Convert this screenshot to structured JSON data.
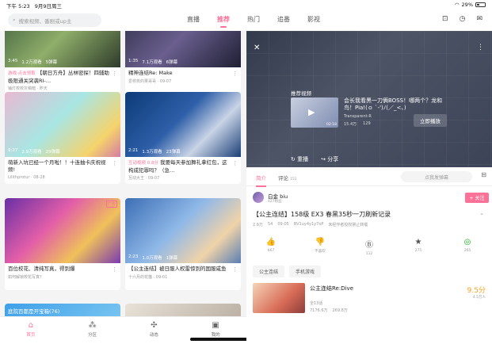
{
  "status": {
    "time": "下午 5:23",
    "date": "9月9日周三",
    "battery": "29%"
  },
  "search": {
    "placeholder": "搜索视频、番剧或up主"
  },
  "tabs": [
    "直播",
    "推荐",
    "热门",
    "追番",
    "影视"
  ],
  "active_tab": "推荐",
  "feed": [
    {
      "duration": "3:45",
      "views": "1.2万观看",
      "danmaku": "5弹幕",
      "tag": "游戏·点击领取",
      "title": "【朝日方舟】丛林密探！四辅助极限通关突袭RI-…",
      "meta": "铺灯校校灰稿暗 · 昨天"
    },
    {
      "duration": "1:35",
      "views": "7.1万观看",
      "danmaku": "6弹幕",
      "title": "精神连结Re: Make",
      "meta": "爱校校的果哥哥 · 09-07"
    },
    {
      "duration": "9:27",
      "views": "2.9万观看",
      "danmaku": "29弹幕",
      "title": "萌新入坑已经一个月啦！！十连抽卡庆祝视频!",
      "meta": "Lilithprotur · 08-28"
    },
    {
      "duration": "2:21",
      "views": "1.3万观看",
      "danmaku": "23弹幕",
      "tag": "互动视频 0.8分",
      "title": "我要每天参加舞礼拿红包，这构成犯罪吗？（急…",
      "meta": "互动大王 · 09-07"
    },
    {
      "ad": "广告",
      "title": "百位校花、清纯写真，得到爆",
      "meta": "如何解锁校花写真？"
    },
    {
      "duration": "2:23",
      "views": "1.0万观看",
      "danmaku": "1弹幕",
      "title": "【公主连结】被日服人权雷惊到的国服咸鱼",
      "meta": "十六月的花猫 · 09-01"
    },
    {
      "title": "庭院百都是开宝箱(76)"
    }
  ],
  "bottom_tabs": [
    "首页",
    "分区",
    "动态",
    "我的"
  ],
  "player": {
    "recommend_label": "推荐视频",
    "rec_title": "会长我看黑一刀俩BOSS！哪两个？龙和鸟！Pia!(ｏ `-')ﾉ(／_<、)",
    "rec_up": "Transparent-R",
    "rec_views": "15.4万",
    "rec_danmaku": "129",
    "rec_duration": "02:18",
    "play_now": "立即播放",
    "replay": "重播",
    "share": "分享"
  },
  "detail_tabs": {
    "intro": "简介",
    "comments": "评论",
    "comment_count": "151",
    "danmaku_placeholder": "点我发弹幕"
  },
  "uploader": {
    "name": "白金 biu",
    "fans": "427粉丝",
    "follow": "+ 关注"
  },
  "video": {
    "title": "【公主连结】158级 EX3 春黑35秒一刀刷新记录",
    "views": "2.6万",
    "danmaku": "54",
    "date": "09-05",
    "bvid": "BV1uy4y1y7oP",
    "notice": "未经作者授权禁止转载"
  },
  "actions": [
    {
      "name": "like",
      "icon": "👍",
      "value": "667"
    },
    {
      "name": "dislike",
      "icon": "👎",
      "value": "不喜欢"
    },
    {
      "name": "coin",
      "icon": "Ⓑ",
      "value": "112"
    },
    {
      "name": "favorite",
      "icon": "★",
      "value": "275"
    },
    {
      "name": "wechat",
      "icon": "◎",
      "value": "265"
    }
  ],
  "chips": [
    "公主连结",
    "手机游戏"
  ],
  "related": {
    "title": "公主连结Re:Dive",
    "subtitle": "全13话",
    "views": "7176.6万",
    "follows": "269.8万",
    "score": "9.5分",
    "score_sub": "4.5万人"
  }
}
